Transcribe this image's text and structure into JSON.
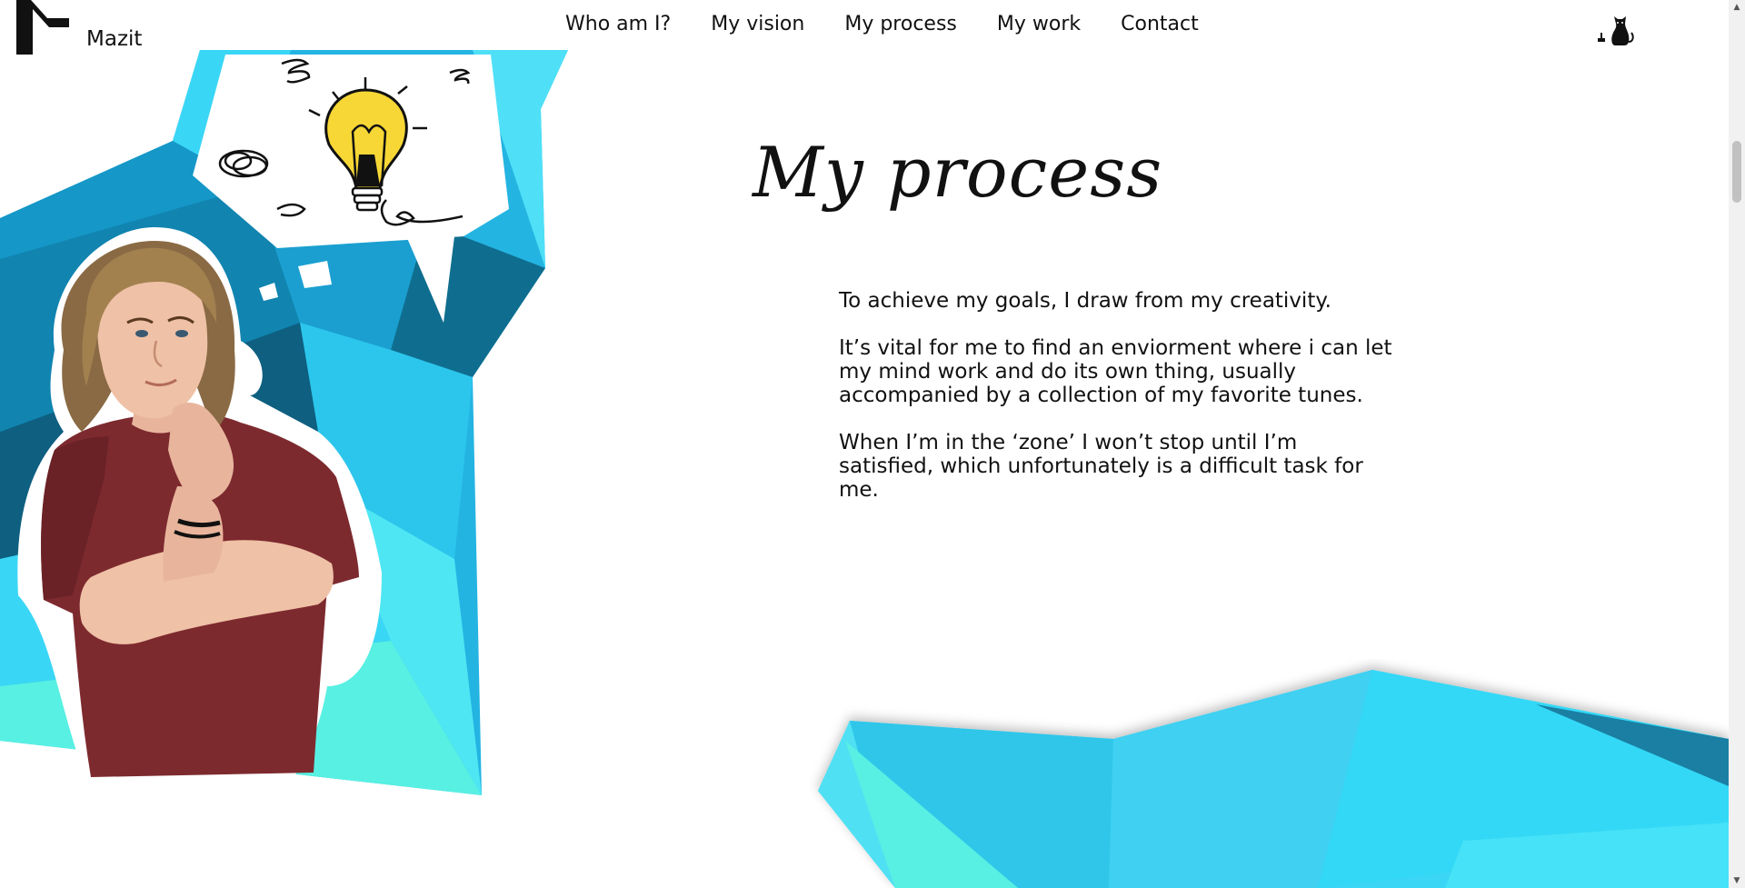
{
  "header": {
    "brand": "Mazit",
    "nav": [
      "Who am I?",
      "My vision",
      "My process",
      "My work",
      "Contact"
    ],
    "logo_icon": "mazit-m-logo-icon",
    "theme_icon": "cat-icon"
  },
  "main": {
    "title": "My process",
    "paragraphs": [
      "To achieve my goals, I draw from my creativity.",
      "It’s vital for me to find an enviorment where i can let my mind work and do its own thing, usually accompanied by a collection of my favorite tunes.",
      "When I’m in the ‘zone’ I won’t stop until I’m satisfied, which unfortunately is a difficult task for me."
    ]
  },
  "colors": {
    "accent_light": "#3ad6f5",
    "accent_mid": "#1aa6d6",
    "accent_dark": "#0f6e8f",
    "accent_mint": "#58f0e2",
    "shirt": "#7d2a2f",
    "bulb": "#f7d736"
  },
  "scrollbar": {
    "up_glyph": "▲",
    "down_glyph": "▼"
  }
}
